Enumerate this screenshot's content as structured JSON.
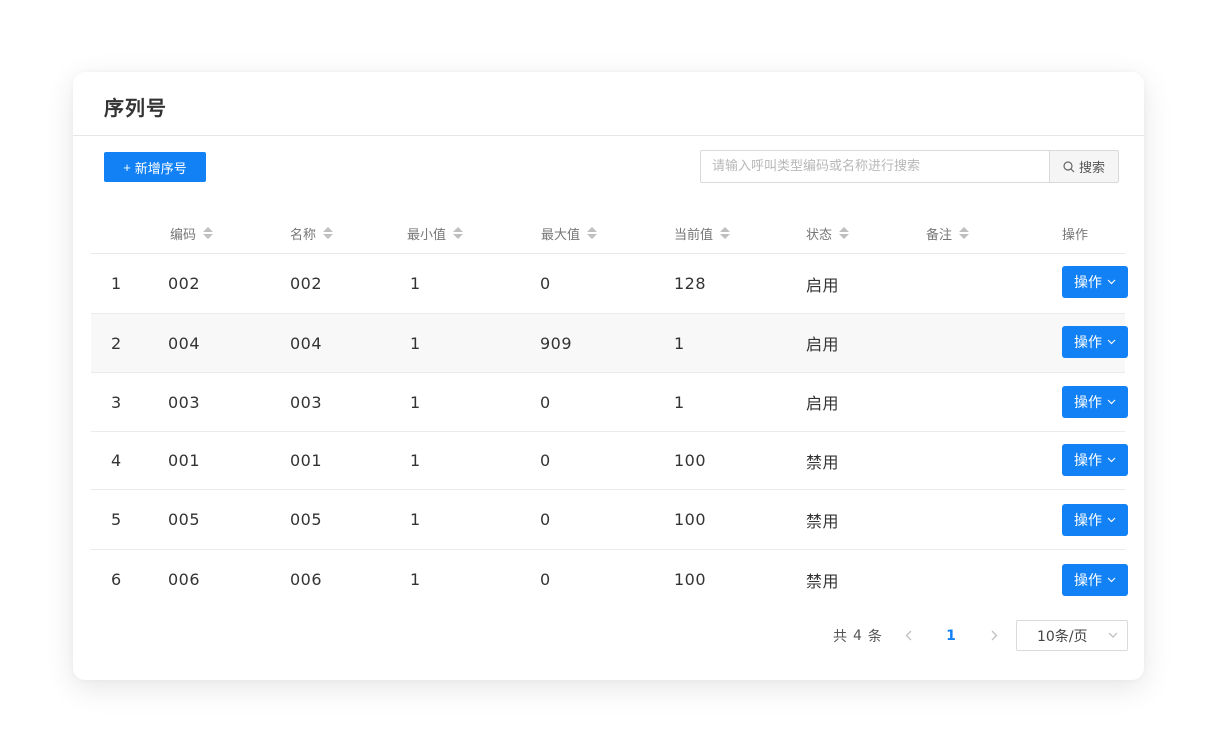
{
  "card": {
    "title": "序列号"
  },
  "toolbar": {
    "add_label": "新增序号",
    "search_placeholder": "请输入呼叫类型编码或名称进行搜索",
    "search_button_label": "搜索"
  },
  "table": {
    "columns": [
      "编码",
      "名称",
      "最小值",
      "最大值",
      "当前值",
      "状态",
      "备注",
      "操作"
    ],
    "rows": [
      {
        "index": "1",
        "code": "002",
        "name": "002",
        "min": "1",
        "max": "0",
        "current": "128",
        "status": "启用",
        "remark": "",
        "action": "操作"
      },
      {
        "index": "2",
        "code": "004",
        "name": "004",
        "min": "1",
        "max": "909",
        "current": "1",
        "status": "启用",
        "remark": "",
        "action": "操作"
      },
      {
        "index": "3",
        "code": "003",
        "name": "003",
        "min": "1",
        "max": "0",
        "current": "1",
        "status": "启用",
        "remark": "",
        "action": "操作"
      },
      {
        "index": "4",
        "code": "001",
        "name": "001",
        "min": "1",
        "max": "0",
        "current": "100",
        "status": "禁用",
        "remark": "",
        "action": "操作"
      },
      {
        "index": "5",
        "code": "005",
        "name": "005",
        "min": "1",
        "max": "0",
        "current": "100",
        "status": "禁用",
        "remark": "",
        "action": "操作"
      },
      {
        "index": "6",
        "code": "006",
        "name": "006",
        "min": "1",
        "max": "0",
        "current": "100",
        "status": "禁用",
        "remark": "",
        "action": "操作"
      }
    ]
  },
  "pagination": {
    "total_prefix": "共",
    "total_count": "4",
    "total_suffix": "条",
    "current_page": "1",
    "page_size": "10条/页"
  },
  "colors": {
    "primary": "#1181f5",
    "row_alt": "#f8f8f8"
  }
}
